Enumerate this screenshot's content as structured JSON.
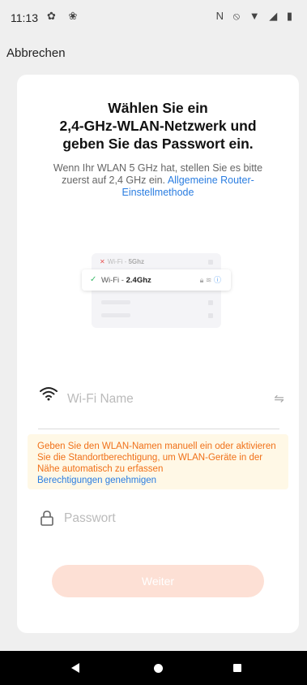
{
  "status_bar": {
    "time": "11:13",
    "left_icons": "✿ ❀",
    "right_icons": "N ⦸ ▼ ◢ ▮"
  },
  "cancel_label": "Abbrechen",
  "title": {
    "line1": "Wählen Sie ein",
    "line2": "2,4-GHz-WLAN-Netzwerk und",
    "line3": "geben Sie das Passwort ein."
  },
  "description": {
    "text": "Wenn Ihr WLAN 5 GHz hat, stellen Sie es bitte zuerst auf 2,4 GHz ein.",
    "link": "Allgemeine Router-Einstellmethode"
  },
  "illustration": {
    "row_5g_prefix": "Wi-Fi - ",
    "row_5g_band": "5Ghz",
    "row_24_prefix": "Wi-Fi - ",
    "row_24_band": "2.4Ghz"
  },
  "wifi_input": {
    "placeholder": "Wi-Fi Name"
  },
  "hint": {
    "text": "Geben Sie den WLAN-Namen manuell ein oder aktivieren Sie die Standortberechtigung, um WLAN-Geräte in der Nähe automatisch zu erfassen",
    "link": "Berechtigungen genehmigen"
  },
  "password_input": {
    "placeholder": "Passwort"
  },
  "next_button": "Weiter",
  "colors": {
    "accent_link": "#2a7de1",
    "hint_text": "#f07018",
    "hint_bg": "#fff8e6",
    "button_disabled": "#fde0d5"
  }
}
